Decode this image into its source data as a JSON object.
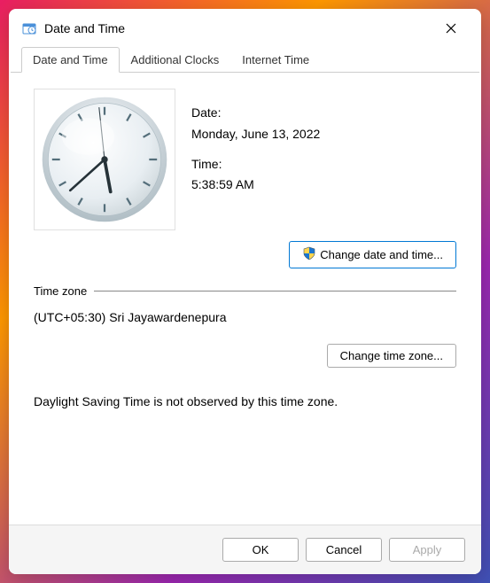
{
  "window": {
    "title": "Date and Time"
  },
  "tabs": [
    {
      "label": "Date and Time",
      "active": true
    },
    {
      "label": "Additional Clocks",
      "active": false
    },
    {
      "label": "Internet Time",
      "active": false
    }
  ],
  "datetime": {
    "date_label": "Date:",
    "date_value": "Monday, June 13, 2022",
    "time_label": "Time:",
    "time_value": "5:38:59 AM",
    "clock": {
      "hour": 5,
      "minute": 38,
      "second": 59
    },
    "change_button": "Change date and time..."
  },
  "timezone": {
    "section_label": "Time zone",
    "value": "(UTC+05:30) Sri Jayawardenepura",
    "change_button": "Change time zone..."
  },
  "dst_notice": "Daylight Saving Time is not observed by this time zone.",
  "footer": {
    "ok": "OK",
    "cancel": "Cancel",
    "apply": "Apply"
  },
  "icons": {
    "title": "datetime-control-icon",
    "close": "close-icon",
    "shield": "uac-shield-icon"
  },
  "colors": {
    "accent": "#0078d4"
  }
}
